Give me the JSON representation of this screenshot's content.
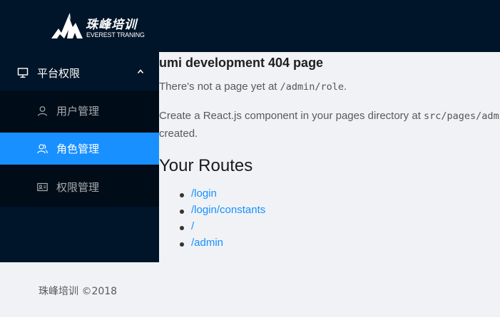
{
  "header": {
    "logo_cn": "珠峰培训",
    "logo_en": "EVEREST TRANING"
  },
  "sidebar": {
    "submenu": {
      "label": "平台权限",
      "icon": "desktop-icon",
      "expanded": true
    },
    "items": [
      {
        "label": "用户管理",
        "icon": "user-icon",
        "selected": false
      },
      {
        "label": "角色管理",
        "icon": "team-icon",
        "selected": true
      },
      {
        "label": "权限管理",
        "icon": "id-card-icon",
        "selected": false
      }
    ]
  },
  "content": {
    "title": "umi development 404 page",
    "line1_prefix": "There's not a page yet at ",
    "line1_code": "/admin/role",
    "line1_suffix": ".",
    "line2_prefix": "Create a React.js component in your pages directory at ",
    "line2_code": "src/pages/admin/role.js",
    "line3": "created.",
    "routes_heading": "Your Routes",
    "routes": [
      "/login",
      "/login/constants",
      "/",
      "/admin"
    ]
  },
  "footer": {
    "text": "珠峰培训 ©2018"
  },
  "colors": {
    "dark_nav": "#001529",
    "submenu_bg": "#000c17",
    "accent": "#1890ff",
    "content_bg": "#f0f2f5"
  }
}
